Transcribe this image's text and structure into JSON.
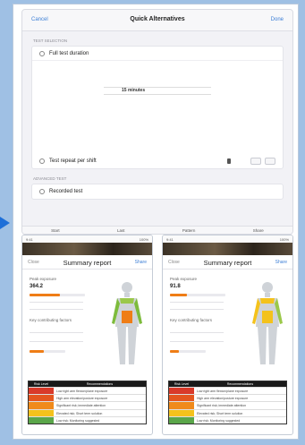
{
  "colors": {
    "background": "#9fc0e4",
    "accent": "#3d7fd6",
    "pointer": "#1e6fd8",
    "orange": "#ef7d16"
  },
  "top_screen": {
    "nav": {
      "cancel": "Cancel",
      "title": "Quick Alternatives",
      "done": "Done"
    },
    "section1_header": "Test Selection",
    "option_full": "Full test duration",
    "picker": [
      "",
      "",
      "15 minutes",
      "",
      ""
    ],
    "option_quick": "Test repeat per shift",
    "section2_header": "Advanced Test",
    "option_record": "Recorded test",
    "toolbar": [
      "Start",
      "Last",
      "Pattern",
      "Share"
    ]
  },
  "left_screen": {
    "status_left": "9:41",
    "status_right": "100%",
    "header": {
      "close": "Close",
      "title": "Summary report",
      "action": "Share"
    },
    "metric1_label": "Peak exposure",
    "metric1_value": "364.2",
    "metric1_fill": 0.55,
    "metric2_label": "Key contributing factors",
    "table_headers": [
      "Risk Level",
      "Recommendations"
    ],
    "rows": [
      "Low right arm flexion/plane exposure",
      "High arm elevation/posture exposure",
      "Significant risk; immediate attention",
      "Elevated risk; Short term solution",
      "Low risk; Monitoring suggested"
    ]
  },
  "right_screen": {
    "status_left": "9:41",
    "status_right": "100%",
    "header": {
      "close": "Close",
      "title": "Summary report",
      "action": "Share"
    },
    "metric1_label": "Peak exposure",
    "metric1_value": "91.8",
    "metric1_fill": 0.3,
    "metric2_label": "Key contributing factors",
    "table_headers": [
      "Risk Level",
      "Recommendations"
    ],
    "rows": [
      "Low right arm flexion/plane exposure",
      "High arm elevation/posture exposure",
      "Significant risk; immediate attention",
      "Elevated risk; Short term solution",
      "Low risk; Monitoring suggested"
    ]
  },
  "risk_colors": [
    "#d93a2a",
    "#e4561f",
    "#f08a1a",
    "#f4c21c",
    "#5aa64a"
  ]
}
